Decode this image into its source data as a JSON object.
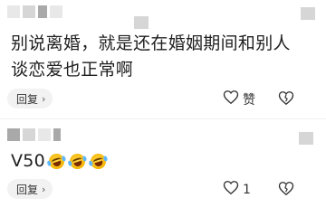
{
  "comments": [
    {
      "username": "",
      "text": "别说离婚，就是还在婚姻期间和别人谈恋爱也正常啊",
      "reply_label": "回复",
      "like_label": "赞",
      "like_icon": "heart-outline-icon",
      "dislike_icon": "broken-heart-icon"
    },
    {
      "username": "",
      "text": "V50",
      "emojis": [
        "laugh-cry-emoji",
        "laugh-cry-emoji",
        "laugh-cry-emoji"
      ],
      "reply_label": "回复",
      "like_label": "1",
      "like_icon": "heart-outline-icon",
      "dislike_icon": "broken-heart-icon"
    }
  ],
  "colors": {
    "text": "#1f1f1f",
    "reply_bg": "#f2f2f2",
    "emoji": "#f4b400"
  }
}
